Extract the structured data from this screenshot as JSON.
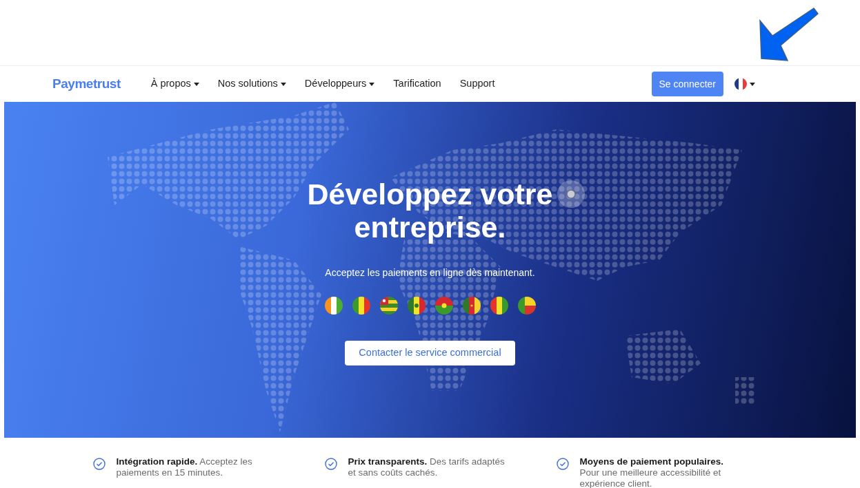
{
  "nav": {
    "logo": "Paymetrust",
    "items": [
      {
        "label": "À propos",
        "dropdown": true
      },
      {
        "label": "Nos solutions",
        "dropdown": true
      },
      {
        "label": "Développeurs",
        "dropdown": true
      },
      {
        "label": "Tarification",
        "dropdown": false
      },
      {
        "label": "Support",
        "dropdown": false
      }
    ],
    "login": "Se connecter"
  },
  "hero": {
    "title_lines": [
      "Développez votre",
      "entreprise."
    ],
    "subtitle": "Acceptez les paiements en ligne dès maintenant.",
    "cta": "Contacter le service commercial"
  },
  "features": [
    "**Intégration rapide.** Acceptez les paiements en 15 minutes.",
    "**Prix transparents.** Des tarifs adaptés et sans coûts cachés.",
    "**Moyens de paiement populaires.** Pour une meilleure accessibilité et expérience client."
  ]
}
